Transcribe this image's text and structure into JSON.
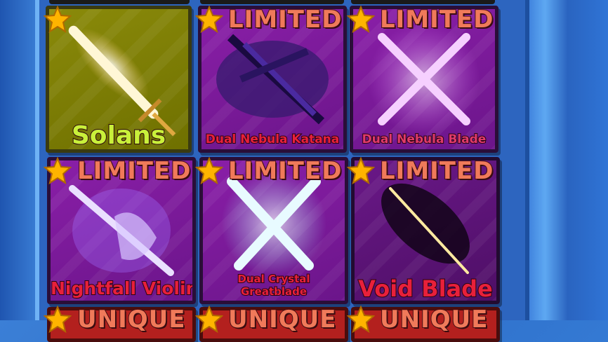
{
  "items": [
    {
      "name": "Solans",
      "tag": "",
      "color": "#c9f03a"
    },
    {
      "name": "Dual Nebula Katana",
      "tag": "LIMITED",
      "color": "#e8203a"
    },
    {
      "name": "Dual Nebula Blade",
      "tag": "LIMITED",
      "color": "#e03a6a"
    },
    {
      "name": "Nightfall Violin",
      "tag": "LIMITED",
      "color": "#e8203a"
    },
    {
      "name": "Dual Crystal Greatblade",
      "tag": "LIMITED",
      "color": "#e8203a"
    },
    {
      "name": "Void Blade",
      "tag": "LIMITED",
      "color": "#e8203a"
    }
  ],
  "bottom_row": [
    {
      "tag": "UNIQUE"
    },
    {
      "tag": "UNIQUE"
    },
    {
      "tag": "UNIQUE"
    }
  ],
  "colors": {
    "background": "#2f6fc9",
    "limited_tag": "#f07a5a",
    "star": "#ffb400"
  }
}
